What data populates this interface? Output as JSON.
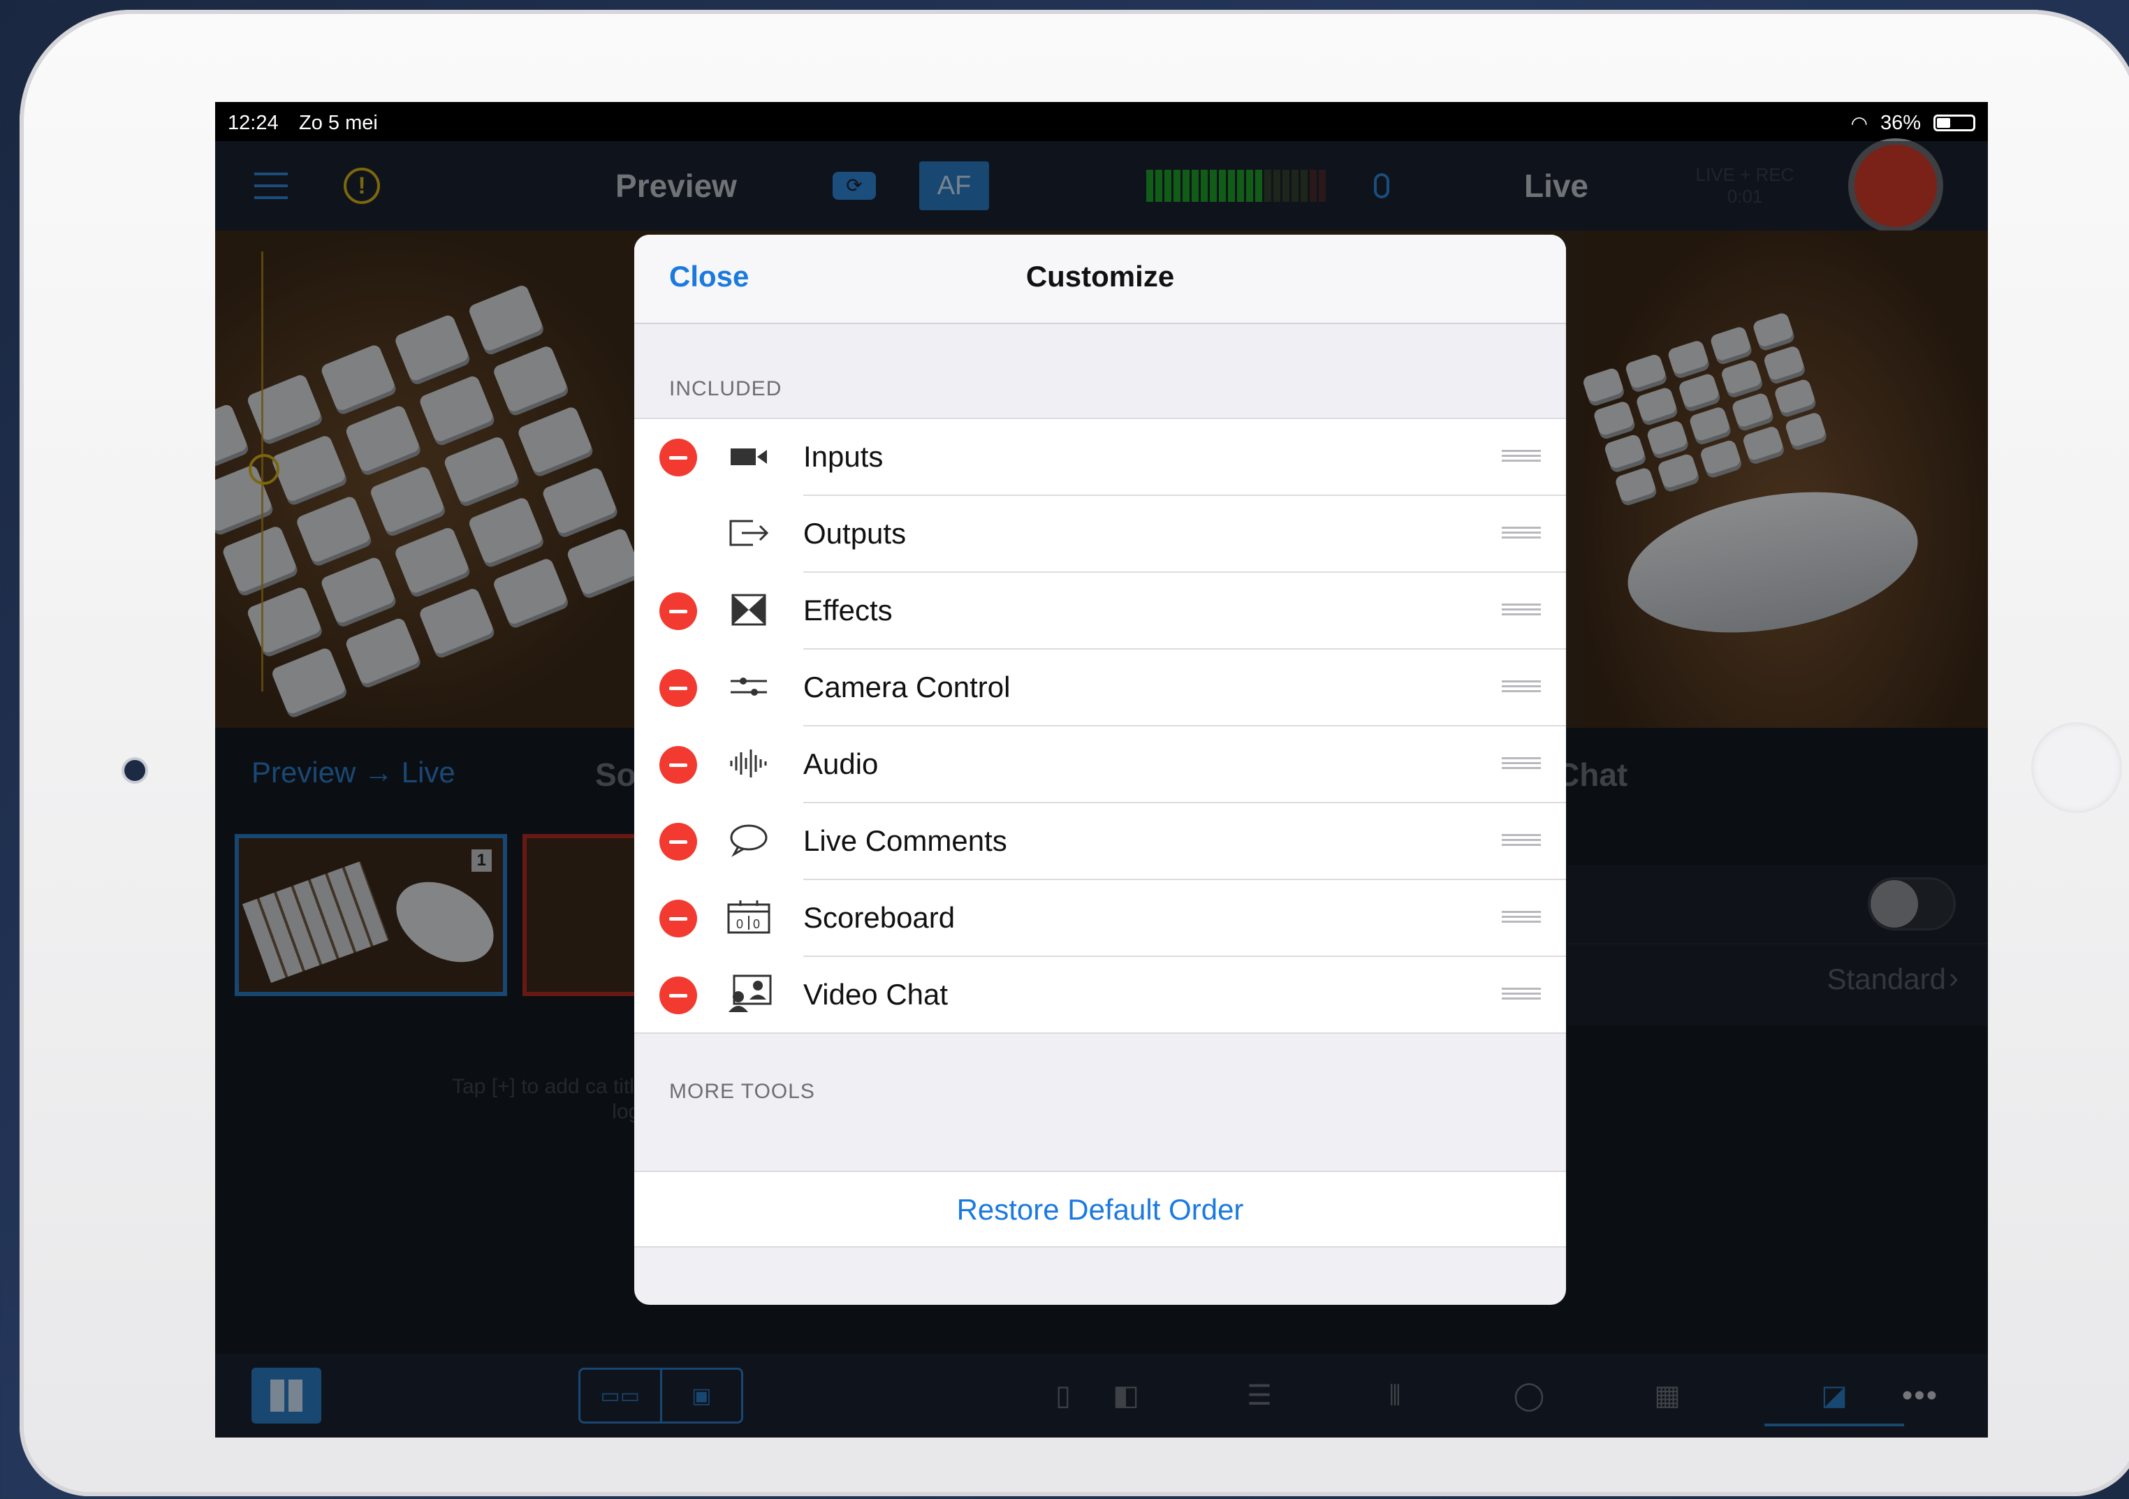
{
  "status_bar": {
    "time": "12:24",
    "date": "Zo 5 mei",
    "battery": "36%",
    "battery_level": 0.36
  },
  "toolbar": {
    "preview_label": "Preview",
    "af_label": "AF",
    "live_label": "Live",
    "live_rec_label": "LIVE + REC",
    "live_rec_time": "0:01"
  },
  "lower": {
    "preview_live_label": "Preview → Live",
    "sources_heading": "So",
    "chat_heading": "Chat",
    "thumb_badge": "1",
    "hint_text": "Tap [+] to add ca titles, logos",
    "standard_label": "Standard",
    "standard_chevron": "›"
  },
  "bottom_bar": {
    "more": "•••"
  },
  "modal": {
    "close": "Close",
    "title": "Customize",
    "included_label": "INCLUDED",
    "more_tools_label": "MORE TOOLS",
    "restore": "Restore Default Order",
    "items": [
      {
        "label": "Inputs",
        "icon": "video-camera-icon",
        "removable": true
      },
      {
        "label": "Outputs",
        "icon": "output-arrow-icon",
        "removable": false
      },
      {
        "label": "Effects",
        "icon": "effects-icon",
        "removable": true
      },
      {
        "label": "Camera Control",
        "icon": "sliders-icon",
        "removable": true
      },
      {
        "label": "Audio",
        "icon": "audio-waveform-icon",
        "removable": true
      },
      {
        "label": "Live Comments",
        "icon": "speech-bubble-icon",
        "removable": true
      },
      {
        "label": "Scoreboard",
        "icon": "scoreboard-icon",
        "removable": true
      },
      {
        "label": "Video Chat",
        "icon": "video-chat-icon",
        "removable": true
      }
    ]
  },
  "colors": {
    "accent": "#1a7ae0",
    "delete_red": "#f23a30",
    "record_red": "#d23a2a",
    "meter_green": "#1ea02a"
  }
}
